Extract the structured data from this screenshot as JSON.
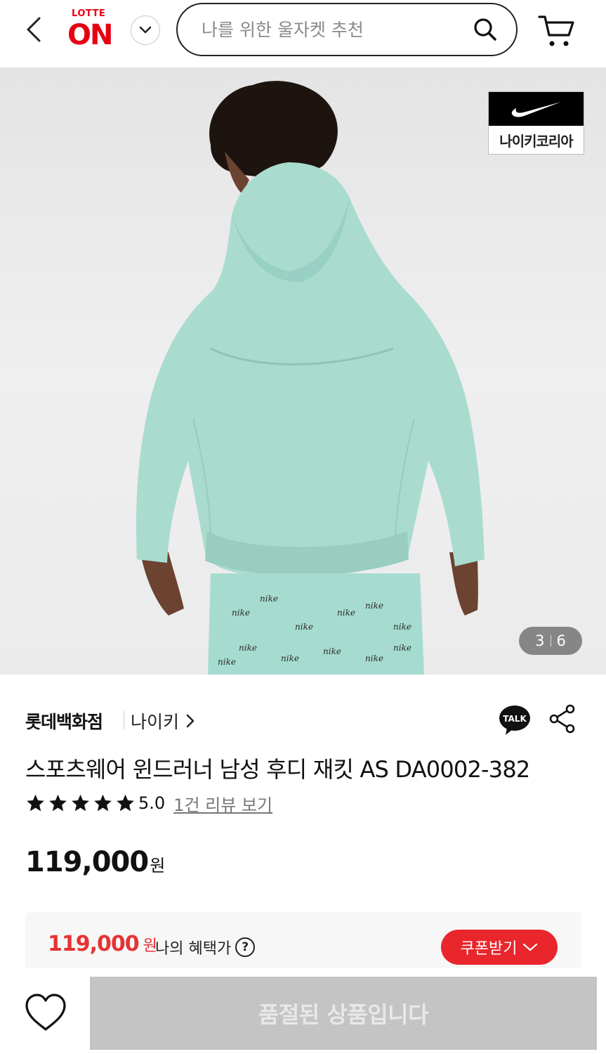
{
  "header": {
    "logo_top": "LOTTE",
    "logo_main": "ON",
    "search_placeholder": "나를 위한 울자켓 추천"
  },
  "image": {
    "current": "3",
    "total": "6",
    "brand_badge": "나이키코리아"
  },
  "seller": {
    "store": "롯데백화점",
    "brand": "나이키",
    "talk": "TALK"
  },
  "product": {
    "title": "스포츠웨어 윈드러너 남성 후디 재킷 AS DA0002-382",
    "rating": "5.0",
    "rating_fraction": 1.0,
    "review_link": "1건 리뷰 보기",
    "price": "119,000",
    "price_unit": "원"
  },
  "benefit": {
    "price": "119,000",
    "unit": "원",
    "label": "나의 혜택가",
    "help": "?",
    "coupon_label": "쿠폰받기"
  },
  "bottom": {
    "soldout_label": "품절된 상품입니다"
  },
  "colors": {
    "brand_red": "#e60012",
    "benefit_red": "#e63333",
    "coupon_bg": "#e8262b",
    "soldout_bg": "#c4c4c4",
    "jacket_mint": "#a8dcd0"
  }
}
